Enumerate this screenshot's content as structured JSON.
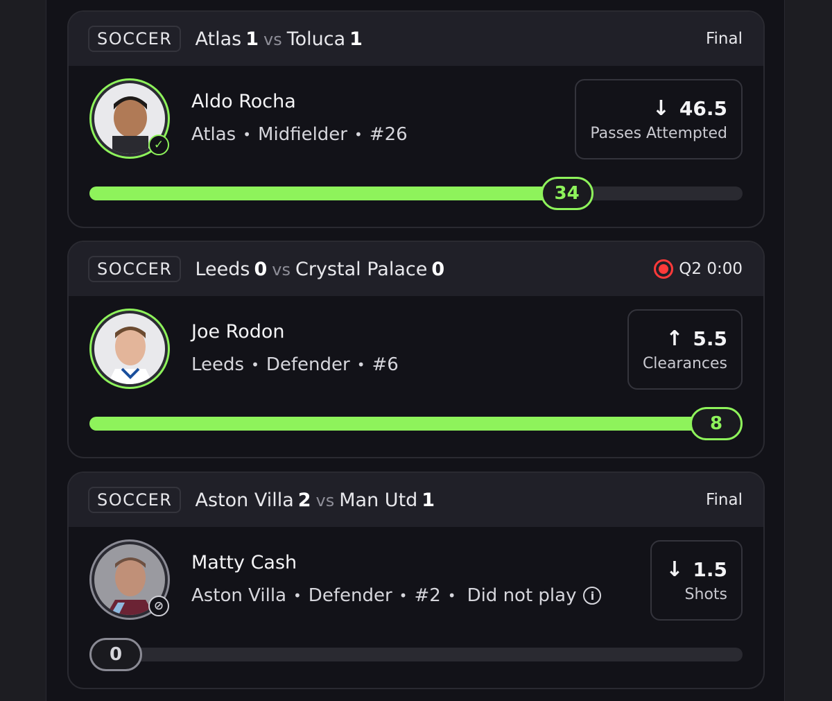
{
  "cards": [
    {
      "sport": "SOCCER",
      "home_team": "Atlas",
      "home_score": "1",
      "vs": "vs",
      "away_team": "Toluca",
      "away_score": "1",
      "status": "Final",
      "player": {
        "name": "Aldo Rocha",
        "team": "Atlas",
        "position": "Midfielder",
        "number": "#26"
      },
      "line": {
        "value": "46.5",
        "stat": "Passes Attempted",
        "direction": "down",
        "arrow": "↓"
      },
      "progress": {
        "value": "34",
        "fraction": 0.731
      },
      "avatar_status": "checkmark-icon",
      "colors": {
        "accent": "#8ef35b"
      }
    },
    {
      "sport": "SOCCER",
      "home_team": "Leeds",
      "home_score": "0",
      "vs": "vs",
      "away_team": "Crystal Palace",
      "away_score": "0",
      "status": "Q2 0:00",
      "live": true,
      "player": {
        "name": "Joe Rodon",
        "team": "Leeds",
        "position": "Defender",
        "number": "#6"
      },
      "line": {
        "value": "5.5",
        "stat": "Clearances",
        "direction": "up",
        "arrow": "↑"
      },
      "progress": {
        "value": "8",
        "fraction": 1.0
      },
      "colors": {
        "accent": "#8ef35b",
        "live": "#ff3a3a"
      }
    },
    {
      "sport": "SOCCER",
      "home_team": "Aston Villa",
      "home_score": "2",
      "vs": "vs",
      "away_team": "Man Utd",
      "away_score": "1",
      "status": "Final",
      "player": {
        "name": "Matty Cash",
        "team": "Aston Villa",
        "position": "Defender",
        "number": "#2",
        "note": "Did not play"
      },
      "line": {
        "value": "1.5",
        "stat": "Shots",
        "direction": "down",
        "arrow": "↓"
      },
      "progress": {
        "value": "0",
        "fraction": 0.0
      },
      "avatar_status": "blocked-icon",
      "colors": {
        "accent": "#8a8a94"
      }
    }
  ]
}
